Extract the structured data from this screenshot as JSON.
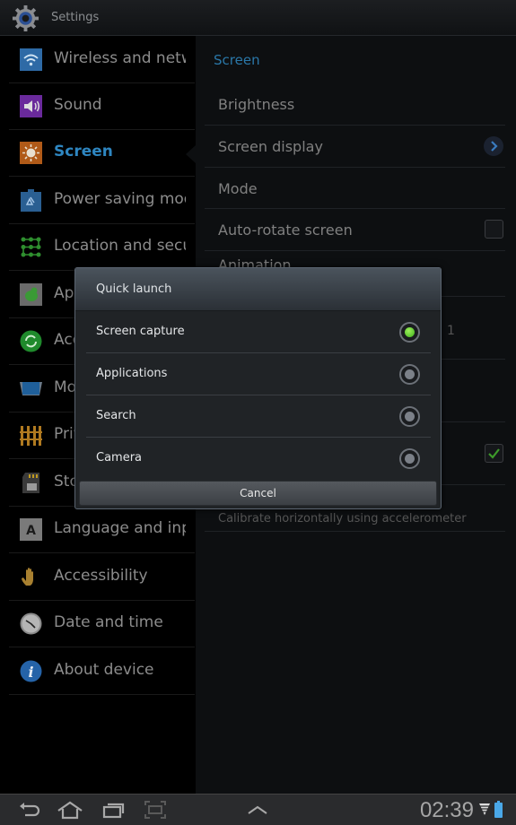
{
  "titlebar": {
    "title": "Settings",
    "icon": "gear-icon"
  },
  "sidebar": {
    "items": [
      {
        "label": "Wireless and networks",
        "icon": "wifi-icon",
        "color": "#3a7bbf",
        "active": false
      },
      {
        "label": "Sound",
        "icon": "speaker-icon",
        "color": "#7b2fb0",
        "active": false
      },
      {
        "label": "Screen",
        "icon": "brightness-icon",
        "color": "#c6661c",
        "active": true
      },
      {
        "label": "Power saving mode",
        "icon": "recycle-battery-icon",
        "color": "#2f6ea8",
        "active": false
      },
      {
        "label": "Location and security",
        "icon": "pattern-lock-icon",
        "color": "#2f8f2f",
        "active": false
      },
      {
        "label": "Applications",
        "icon": "android-icon",
        "color": "#3a9a35",
        "active": false
      },
      {
        "label": "Accounts and sync",
        "icon": "sync-icon",
        "color": "#2c9a3a",
        "active": false
      },
      {
        "label": "Motion",
        "icon": "motion-icon",
        "color": "#1f5f9a",
        "active": false
      },
      {
        "label": "Privacy",
        "icon": "privacy-fence-icon",
        "color": "#c08a25",
        "active": false
      },
      {
        "label": "Storage",
        "icon": "sd-card-icon",
        "color": "#9a9a9a",
        "active": false
      },
      {
        "label": "Language and input",
        "icon": "keyboard-a-icon",
        "color": "#9a9a9a",
        "active": false
      },
      {
        "label": "Accessibility",
        "icon": "hand-icon",
        "color": "#b08a30",
        "active": false
      },
      {
        "label": "Date and time",
        "icon": "clock-icon",
        "color": "#9a9a9a",
        "active": false
      },
      {
        "label": "About device",
        "icon": "info-icon",
        "color": "#2d6fb3",
        "active": false
      }
    ]
  },
  "panel": {
    "header": "Screen",
    "rows": [
      {
        "label": "Brightness"
      },
      {
        "label": "Screen display",
        "control": "chevron"
      },
      {
        "label": "Mode"
      },
      {
        "label": "Auto-rotate screen",
        "control": "checkbox",
        "checked": false
      },
      {
        "label": "Animation"
      },
      {
        "label": "",
        "value": "1"
      },
      {
        "label": ""
      },
      {
        "label": "",
        "control": "checkbox",
        "checked": true
      },
      {
        "label": "",
        "sub": "Calibrate horizontally using accelerometer"
      }
    ]
  },
  "dialog": {
    "title": "Quick launch",
    "options": [
      {
        "label": "Screen capture",
        "selected": true
      },
      {
        "label": "Applications",
        "selected": false
      },
      {
        "label": "Search",
        "selected": false
      },
      {
        "label": "Camera",
        "selected": false
      }
    ],
    "cancel_label": "Cancel"
  },
  "navbar": {
    "buttons": [
      "back-icon",
      "home-icon",
      "recent-apps-icon",
      "screenshot-icon",
      "expand-up-icon"
    ],
    "time": "02:39",
    "status_icons": [
      "signal-icon",
      "battery-icon"
    ],
    "accent": "#4aa8e8"
  }
}
